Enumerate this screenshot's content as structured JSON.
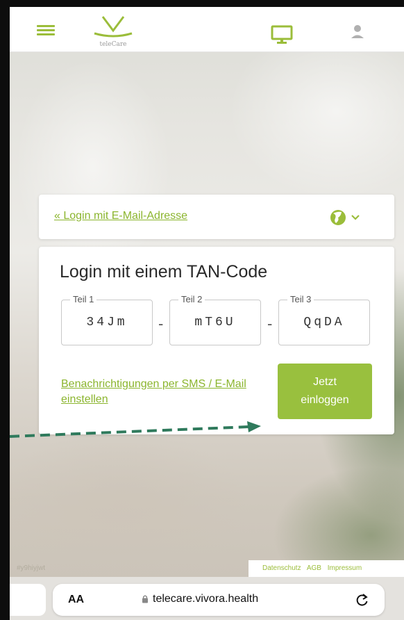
{
  "header": {
    "logo_text": "teleCare",
    "accent_color": "#9bbd3a",
    "icons": [
      "hamburger-menu-icon",
      "monitor-icon",
      "user-icon"
    ]
  },
  "language_card": {
    "email_login_link": "« Login mit E-Mail-Adresse",
    "language_icon": "globe-icon"
  },
  "tan_card": {
    "title": "Login mit einem TAN-Code",
    "fields": [
      {
        "label": "Teil 1",
        "value": "34Jm"
      },
      {
        "label": "Teil 2",
        "value": "mT6U"
      },
      {
        "label": "Teil 3",
        "value": "QqDA"
      }
    ],
    "separator": "-",
    "notification_link": "Benachrichtigungen per SMS / E-Mail einstellen",
    "login_button_line1": "Jetzt",
    "login_button_line2": "einloggen"
  },
  "footer": {
    "hashtag": "#y9hiyjwt",
    "links": [
      "Datenschutz",
      "AGB",
      "Impressum"
    ]
  },
  "browser": {
    "text_size_label": "AA",
    "url": "telecare.vivora.health"
  },
  "colors": {
    "button": "#99c03e",
    "link": "#8bb52e",
    "arrow": "#2f7a5c"
  }
}
